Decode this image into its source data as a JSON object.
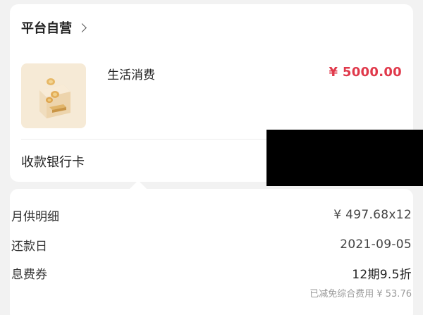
{
  "store": {
    "name": "平台自营",
    "chevron_icon": "chevron-right-icon"
  },
  "product": {
    "name": "生活消费",
    "price": "¥ 5000.00",
    "thumb_icon": "coins-box-icon"
  },
  "bank": {
    "label": "收款银行卡"
  },
  "details": {
    "monthly_label": "月供明细",
    "monthly_value": "¥ 497.68x12",
    "due_label": "还款日",
    "due_value": "2021-09-05",
    "coupon_label": "息费券",
    "coupon_value": "12期9.5折",
    "coupon_note": "已减免综合费用 ¥ 53.76"
  },
  "colors": {
    "price": "#e0394b",
    "thumb_bg": "#f6ead6",
    "page_bg": "#f2f2f2"
  }
}
